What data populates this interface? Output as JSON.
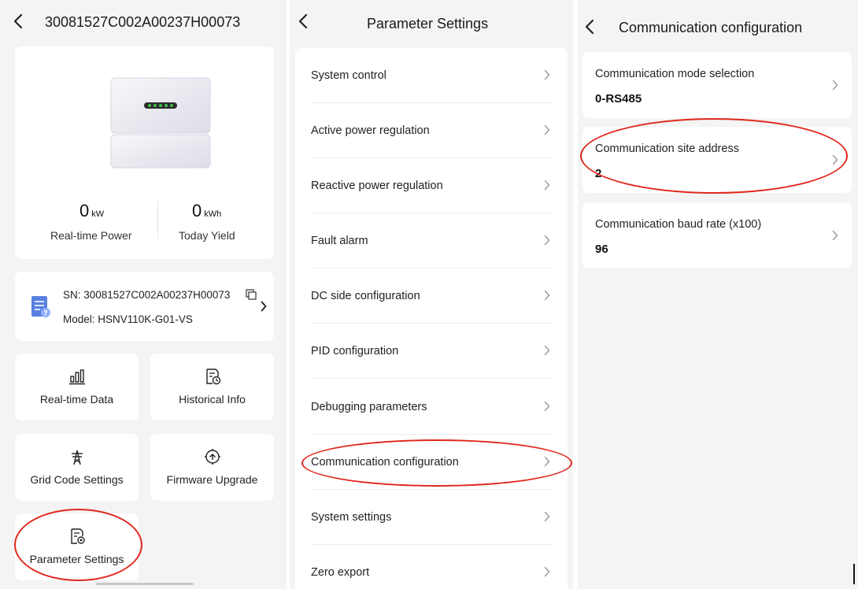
{
  "colors": {
    "accent": "#e0271c",
    "background": "#f4f4f4",
    "card": "#ffffff",
    "indicator_led": "#3ec24a"
  },
  "device_panel": {
    "title": "30081527C002A00237H00073",
    "realtime_power": {
      "value": "0",
      "unit": "kW",
      "label": "Real-time Power"
    },
    "today_yield": {
      "value": "0",
      "unit": "kWh",
      "label": "Today Yield"
    },
    "info": {
      "sn": "SN: 30081527C002A00237H00073",
      "model": "Model: HSNV110K-G01-VS",
      "icon": "document-help-icon",
      "copy_icon": "copy-icon"
    },
    "tiles": [
      {
        "label": "Real-time Data",
        "icon": "bar-chart-icon"
      },
      {
        "label": "Historical Info",
        "icon": "history-document-icon"
      },
      {
        "label": "Grid Code Settings",
        "icon": "power-tower-icon"
      },
      {
        "label": "Firmware Upgrade",
        "icon": "upgrade-icon"
      },
      {
        "label": "Parameter Settings",
        "icon": "settings-document-icon"
      }
    ]
  },
  "parameter_panel": {
    "title": "Parameter Settings",
    "items": [
      "System control",
      "Active power regulation",
      "Reactive power regulation",
      "Fault alarm",
      "DC side configuration",
      "PID configuration",
      "Debugging parameters",
      "Communication configuration",
      "System settings",
      "Zero export"
    ]
  },
  "comm_panel": {
    "title": "Communication configuration",
    "items": [
      {
        "label": "Communication mode selection",
        "value": "0-RS485"
      },
      {
        "label": "Communication site address",
        "value": "2"
      },
      {
        "label": "Communication baud rate (x100)",
        "value": "96"
      }
    ]
  }
}
